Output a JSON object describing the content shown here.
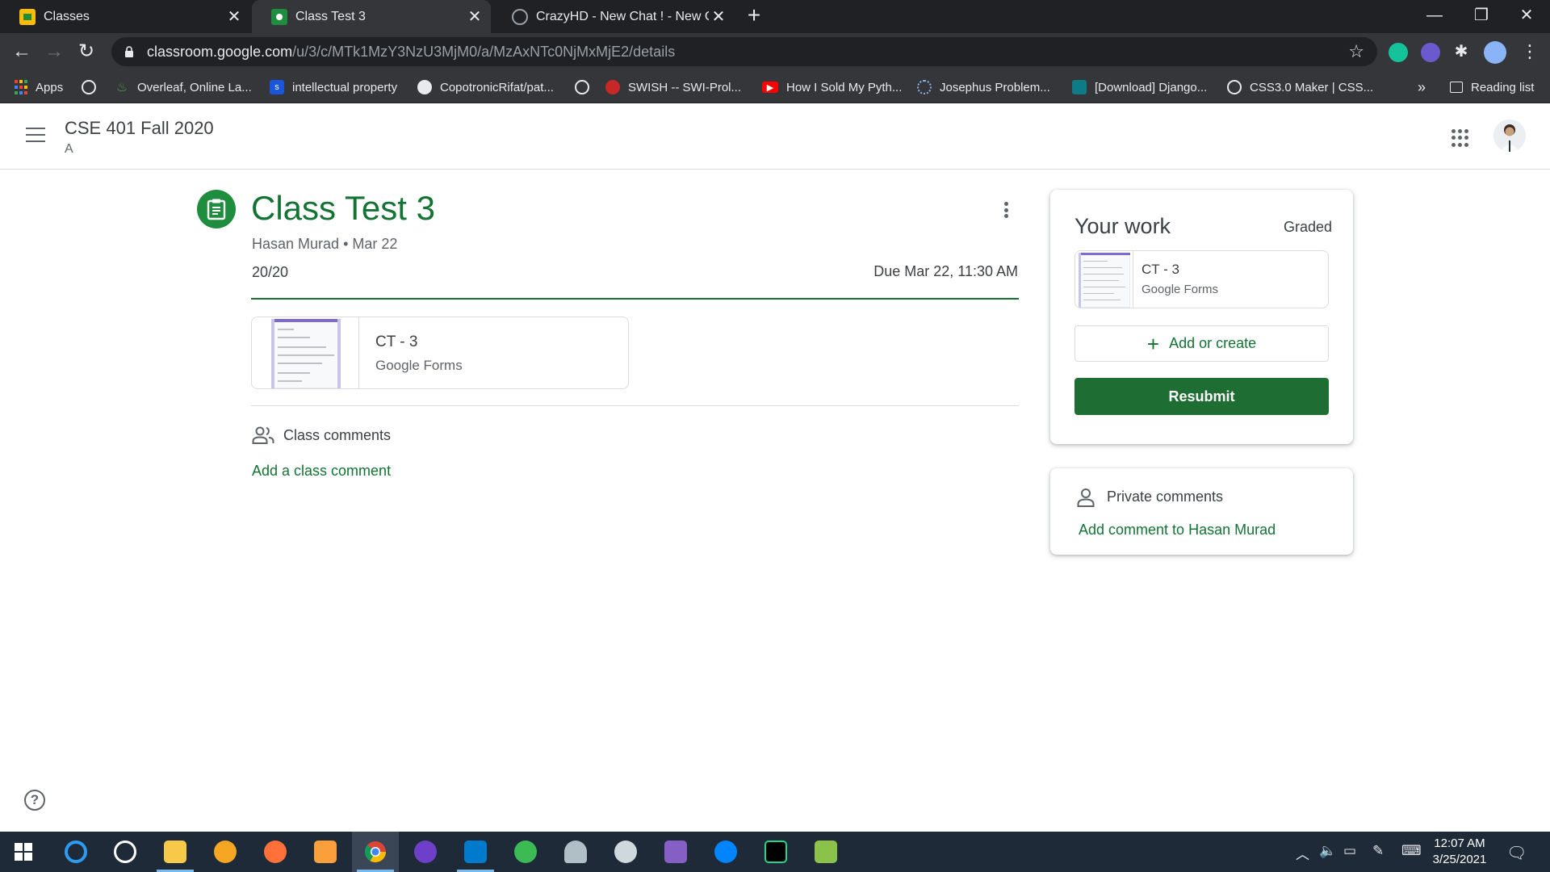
{
  "browser": {
    "tabs": [
      {
        "title": "Classes",
        "active": false
      },
      {
        "title": "Class Test 3",
        "active": true
      },
      {
        "title": "CrazyHD - New Chat ! - New Cha",
        "active": false
      }
    ],
    "url_host": "classroom.google.com",
    "url_path": "/u/3/c/MTk1MzY3NzU3MjM0/a/MzAxNTc0NjMxMjE2/details",
    "bookmarks": [
      {
        "label": "Apps",
        "icon": "apps-grid-icon"
      },
      {
        "label": "",
        "icon": "globe-icon"
      },
      {
        "label": "Overleaf, Online La...",
        "icon": "overleaf-icon"
      },
      {
        "label": "intellectual property",
        "icon": "s-icon"
      },
      {
        "label": "CopotronicRifat/pat...",
        "icon": "github-icon"
      },
      {
        "label": "",
        "icon": "globe-icon"
      },
      {
        "label": "SWISH -- SWI-Prol...",
        "icon": "swish-icon"
      },
      {
        "label": "How I Sold My Pyth...",
        "icon": "youtube-icon"
      },
      {
        "label": "Josephus Problem...",
        "icon": "loading-icon"
      },
      {
        "label": "[Download] Django...",
        "icon": "django-icon"
      },
      {
        "label": "CSS3.0 Maker | CSS...",
        "icon": "globe-icon"
      }
    ],
    "overflow": "»",
    "reading_list": "Reading list"
  },
  "header": {
    "class_name": "CSE 401 Fall 2020",
    "section": "A"
  },
  "assignment": {
    "title": "Class Test 3",
    "author": "Hasan Murad",
    "date": "Mar 22",
    "points": "20/20",
    "due": "Due Mar 22, 11:30 AM",
    "attachment": {
      "title": "CT - 3",
      "subtitle": "Google Forms"
    },
    "class_comments_label": "Class comments",
    "add_class_comment": "Add a class comment"
  },
  "your_work": {
    "title": "Your work",
    "status": "Graded",
    "attachment": {
      "title": "CT - 3",
      "subtitle": "Google Forms"
    },
    "add_or_create": "Add or create",
    "resubmit": "Resubmit"
  },
  "private_comments": {
    "label": "Private comments",
    "add": "Add comment to Hasan Murad"
  },
  "taskbar": {
    "time": "12:07 AM",
    "date": "3/25/2021"
  },
  "colors": {
    "classroom_green": "#137333",
    "button_green": "#1e6e34",
    "chrome_dark": "#202124",
    "taskbar": "#1e2a38"
  }
}
